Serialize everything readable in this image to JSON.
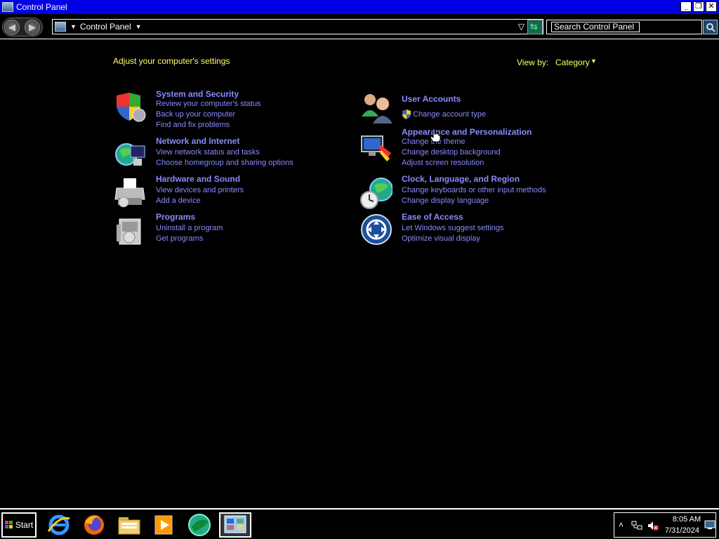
{
  "window": {
    "title": "Control Panel"
  },
  "titlebar_buttons": {
    "minimize": "_",
    "restore": "❐",
    "close": "✕"
  },
  "address": {
    "path": "Control Panel"
  },
  "search": {
    "placeholder": "Search Control Panel"
  },
  "heading": "Adjust your computer's settings",
  "view_by": {
    "label": "View by:",
    "value": "Category"
  },
  "categories": [
    {
      "title": "System and Security",
      "icon": "shield-icon",
      "links": [
        "Review your computer's status",
        "Back up your computer",
        "Find and fix problems"
      ]
    },
    {
      "title": "Network and Internet",
      "icon": "globe-network-icon",
      "links": [
        "View network status and tasks",
        "Choose homegroup and sharing options"
      ]
    },
    {
      "title": "Hardware and Sound",
      "icon": "printer-icon",
      "links": [
        "View devices and printers",
        "Add a device"
      ]
    },
    {
      "title": "Programs",
      "icon": "programs-icon",
      "links": [
        "Uninstall a program",
        "Get programs"
      ]
    },
    {
      "title": "User Accounts",
      "icon": "users-icon",
      "links": [
        "Change account type"
      ]
    },
    {
      "title": "Appearance and Personalization",
      "icon": "monitor-paint-icon",
      "links": [
        "Change the theme",
        "Change desktop background",
        "Adjust screen resolution"
      ]
    },
    {
      "title": "Clock, Language, and Region",
      "icon": "clock-globe-icon",
      "links": [
        "Change keyboards or other input methods",
        "Change display language"
      ]
    },
    {
      "title": "Ease of Access",
      "icon": "ease-of-access-icon",
      "links": [
        "Let Windows suggest settings",
        "Optimize visual display"
      ]
    }
  ],
  "taskbar": {
    "start_label": "Start",
    "pinned": [
      "internet-explorer-icon",
      "firefox-icon",
      "folder-icon",
      "media-player-icon",
      "app-icon",
      "control-panel-icon"
    ],
    "tray": {
      "time": "8:05 AM",
      "date": "7/31/2024"
    }
  },
  "colors": {
    "link": "#8a8aff",
    "heading": "#ffff66",
    "titlebar": "#0000e6"
  }
}
